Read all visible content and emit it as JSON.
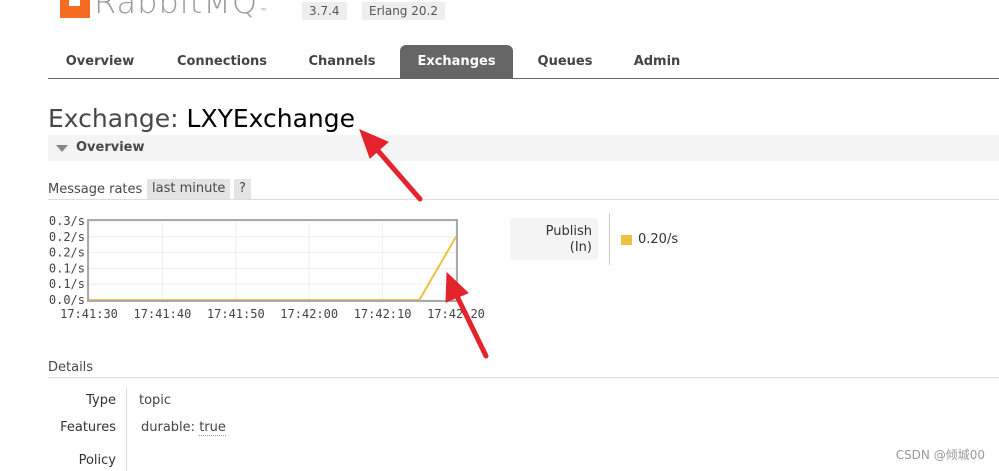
{
  "header": {
    "logo_text": "RabbitMQ",
    "logo_tm": "™",
    "version": "3.7.4",
    "erlang": "Erlang 20.2"
  },
  "tabs": [
    {
      "label": "Overview"
    },
    {
      "label": "Connections"
    },
    {
      "label": "Channels"
    },
    {
      "label": "Exchanges",
      "active": true
    },
    {
      "label": "Queues"
    },
    {
      "label": "Admin"
    }
  ],
  "page": {
    "title_prefix": "Exchange:",
    "exchange_name": "LXYExchange"
  },
  "overview": {
    "section_label": "Overview",
    "message_rates_label": "Message rates",
    "range_button": "last minute",
    "help_button": "?"
  },
  "chart_data": {
    "type": "line",
    "title": "",
    "xlabel": "",
    "ylabel": "",
    "x_tick_labels": [
      "17:41:30",
      "17:41:40",
      "17:41:50",
      "17:42:00",
      "17:42:10",
      "17:42:20"
    ],
    "y_tick_labels": [
      "0.0/s",
      "0.1/s",
      "0.1/s",
      "0.2/s",
      "0.2/s",
      "0.3/s"
    ],
    "y_tick_values": [
      0.0,
      0.05,
      0.1,
      0.15,
      0.2,
      0.25
    ],
    "ylim": [
      0,
      0.25
    ],
    "x_range_seconds": [
      0,
      50
    ],
    "series": [
      {
        "name": "Publish (In)",
        "color": "#edc240",
        "x_seconds": [
          0,
          45,
          50
        ],
        "values": [
          0,
          0,
          0.2
        ]
      }
    ],
    "grid": true
  },
  "legend": {
    "label_line1": "Publish",
    "label_line2": "(In)",
    "value": "0.20/s",
    "color": "#edc240"
  },
  "details": {
    "section_label": "Details",
    "type_label": "Type",
    "type_value": "topic",
    "features_label": "Features",
    "features_key": "durable:",
    "features_value": "true",
    "policy_label": "Policy"
  },
  "watermark": "CSDN @倾城00",
  "colors": {
    "accent": "#f36c21",
    "tab_active": "#666666",
    "series": "#edc240",
    "arrow": "#e5232c"
  }
}
